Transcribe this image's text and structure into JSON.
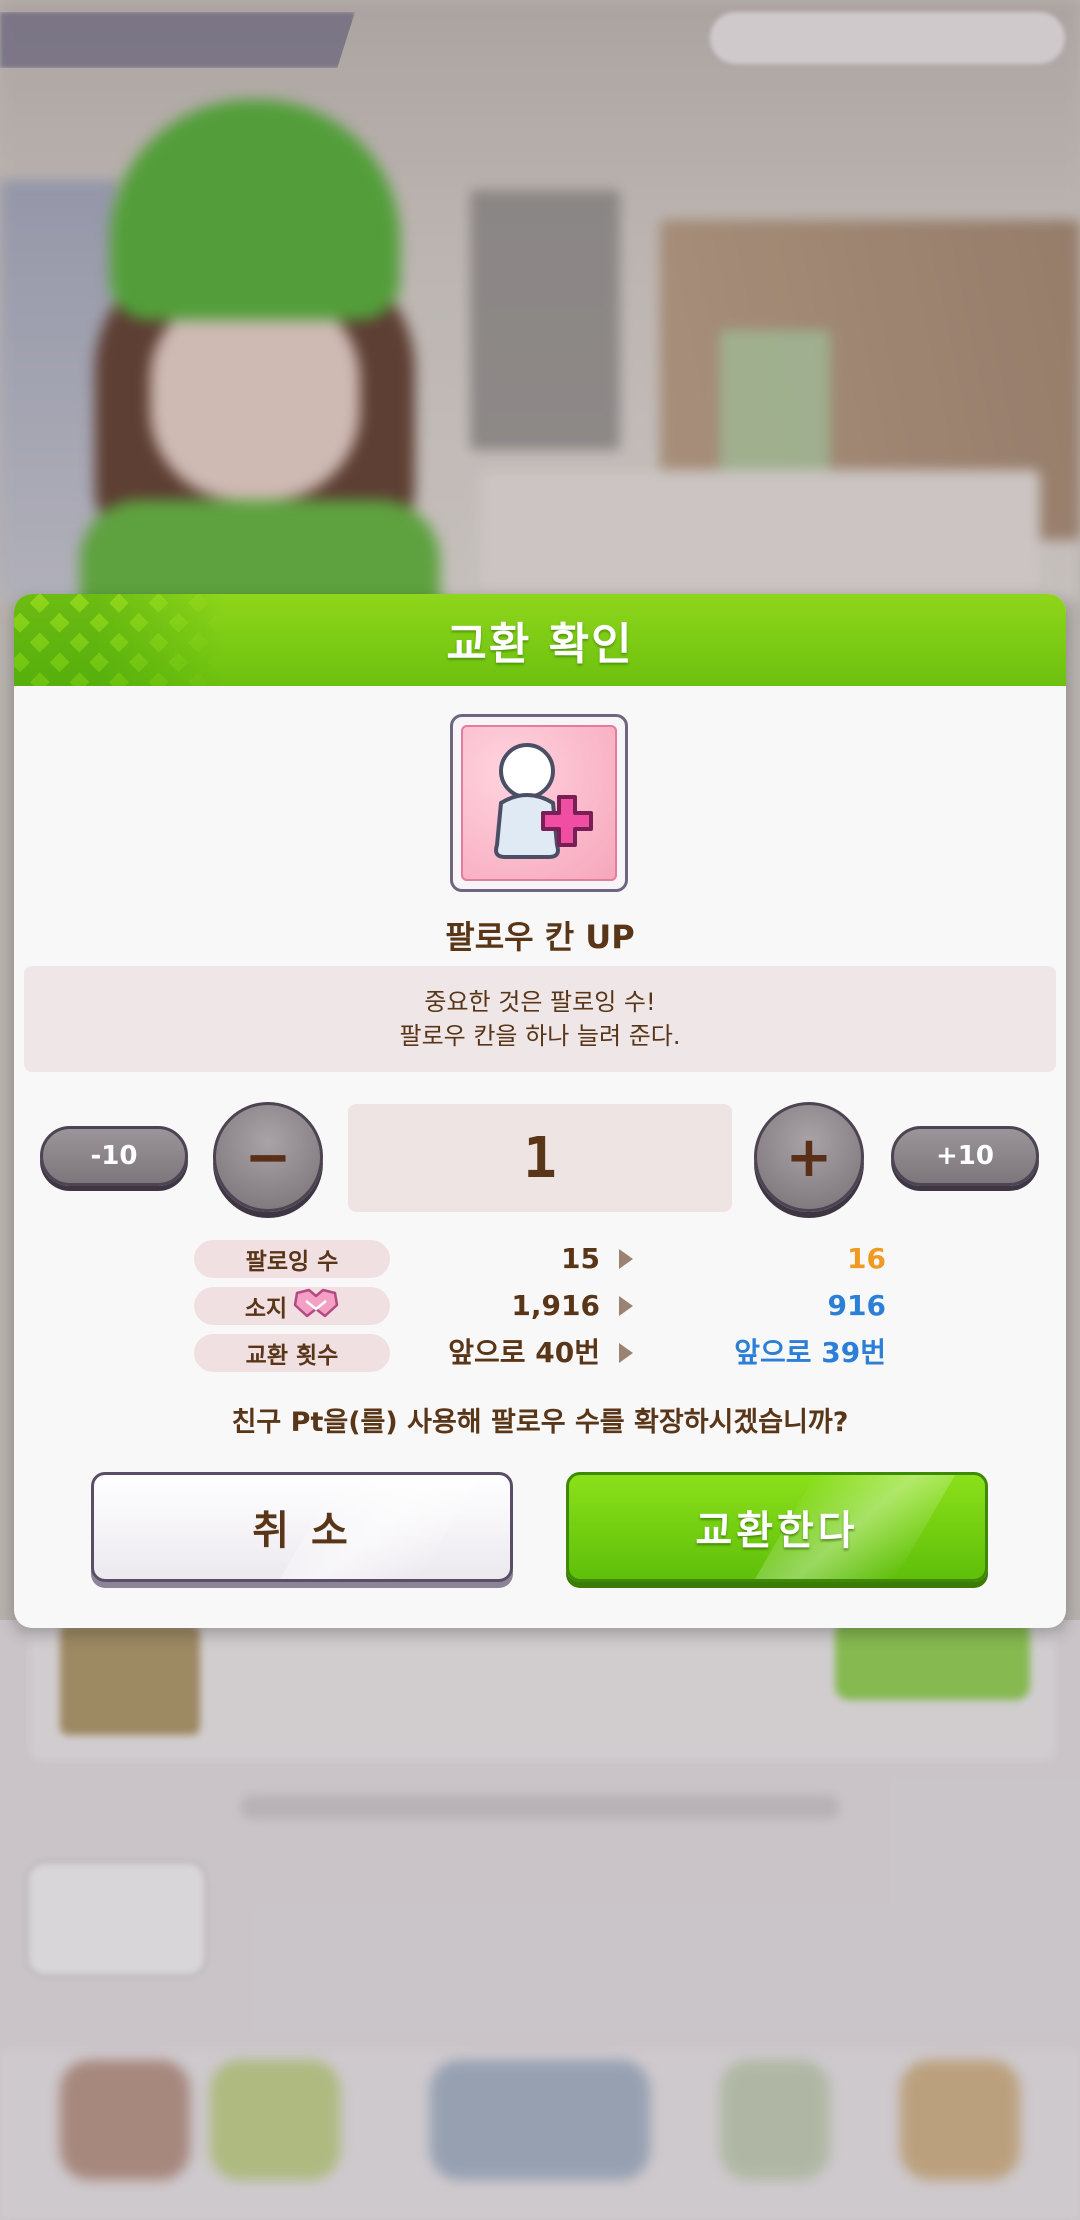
{
  "dialog": {
    "title": "교환 확인",
    "item_name": "팔로우 칸 UP",
    "description_line1": "중요한 것은 팔로잉 수!",
    "description_line2": "팔로우 칸을 하나 늘려 준다.",
    "quantity": {
      "minus10_label": "-10",
      "minus_label": "−",
      "value": "1",
      "plus_label": "+",
      "plus10_label": "+10"
    },
    "rows": [
      {
        "label": "팔로잉 수",
        "icon": "",
        "current": "15",
        "next": "16",
        "next_color": "#f09a22"
      },
      {
        "label": "소지",
        "icon": "handshake-icon",
        "current": "1,916",
        "next": "916",
        "next_color": "#2c7fd6"
      },
      {
        "label": "교환 횟수",
        "icon": "",
        "current": "앞으로 40번",
        "next": "앞으로 39번",
        "next_color": "#2c7fd6"
      }
    ],
    "question": "친구 Pt을(를) 사용해 팔로우 수를 확장하시겠습니까?",
    "cancel_label": "취 소",
    "confirm_label": "교환한다"
  },
  "colors": {
    "header_green": "#7ccd16",
    "text_brown": "#5a3619",
    "increase_orange": "#f09a22",
    "decrease_blue": "#2c7fd6"
  }
}
